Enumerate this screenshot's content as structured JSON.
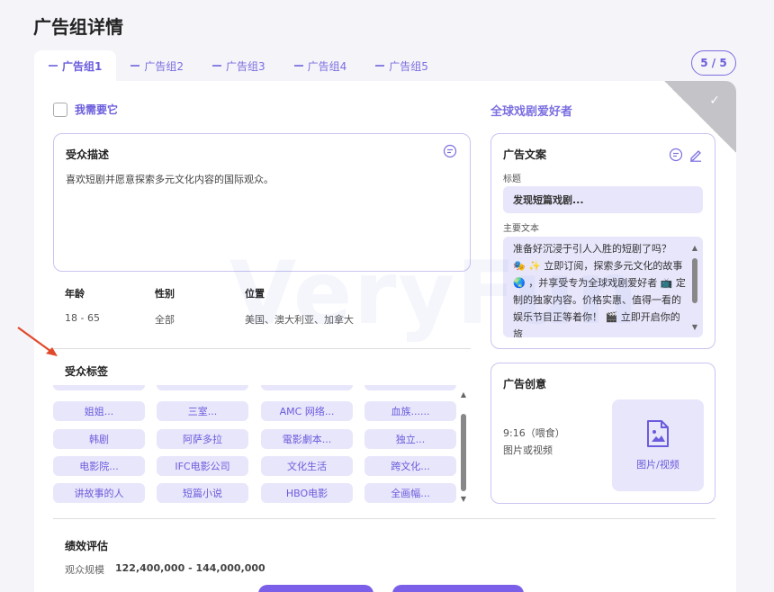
{
  "page": {
    "title": "广告组详情",
    "watermark": "VeryFun"
  },
  "tabs": [
    {
      "label": "广告组1",
      "active": true
    },
    {
      "label": "广告组2",
      "active": false
    },
    {
      "label": "广告组3",
      "active": false
    },
    {
      "label": "广告组4",
      "active": false
    },
    {
      "label": "广告组5",
      "active": false
    }
  ],
  "counter": "5 / 5",
  "checkbox": {
    "label": "我需要它",
    "checked": false
  },
  "selected_title": "全球戏剧爱好者",
  "audience": {
    "title": "受众描述",
    "text": "喜欢短剧并愿意探索多元文化内容的国际观众。",
    "age_label": "年龄",
    "age_value": "18 - 65",
    "gender_label": "性别",
    "gender_value": "全部",
    "location_label": "位置",
    "location_value": "美国、澳大利亚、加拿大"
  },
  "tags": {
    "title": "受众标签",
    "items": [
      "",
      "",
      "",
      "",
      "姐姐...",
      "三室...",
      "AMC 网络...",
      "血族......",
      "韩剧",
      "阿萨多拉",
      "電影劇本...",
      "独立...",
      "电影院...",
      "IFC电影公司",
      "文化生活",
      "跨文化...",
      "讲故事的人",
      "短篇小说",
      "HBO电影",
      "全画幅..."
    ]
  },
  "ad_copy": {
    "title": "广告文案",
    "headline_label": "标题",
    "headline": "发现短篇戏剧...",
    "body_label": "主要文本",
    "body": "准备好沉浸于引人入胜的短剧了吗？ 🎭 ✨ 立即订阅，探索多元文化的故事 🌏 ，并享受专为全球戏剧爱好者 📺 定制的独家内容。价格实惠、值得一看的娱乐节目正等着你！ 🎬 立即开启你的旅"
  },
  "creative": {
    "title": "广告创意",
    "ratio": "9:16（喂食）",
    "format": "图片或视频",
    "media_label": "图片/视频"
  },
  "evaluation": {
    "title": "绩效评估",
    "reach_label": "观众规模",
    "reach_value": "122,400,000 - 144,000,000"
  },
  "colors": {
    "accent": "#6a5cdc",
    "tag_bg": "#e8e6fb",
    "button": "#7b5fe8",
    "arrow": "#e04a2a"
  }
}
